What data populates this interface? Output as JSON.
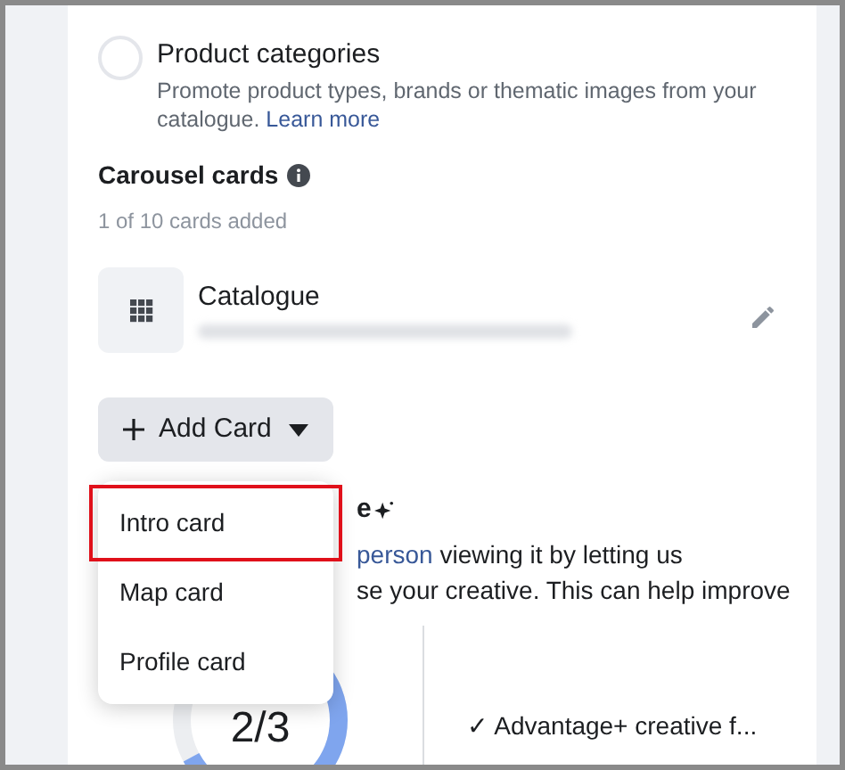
{
  "option": {
    "title": "Product categories",
    "description": "Promote product types, brands or thematic images from your catalogue.",
    "link": "Learn more",
    "selected": false
  },
  "carousel": {
    "title": "Carousel cards",
    "count": "1 of 10 cards added"
  },
  "card": {
    "title": "Catalogue"
  },
  "add_button": {
    "label": "Add Card",
    "expanded": true
  },
  "menu": [
    {
      "label": "Intro card",
      "highlighted": true
    },
    {
      "label": "Map card",
      "highlighted": false
    },
    {
      "label": "Profile card",
      "highlighted": false
    }
  ],
  "hidden_section": {
    "heading_tail": "e",
    "line_1_link": "person",
    "line_1": " viewing it by letting us",
    "line_2": "se your creative. This can help improve"
  },
  "score": {
    "text": "2/3"
  },
  "checklist": [
    "✓ Advantage+ creative f..."
  ]
}
